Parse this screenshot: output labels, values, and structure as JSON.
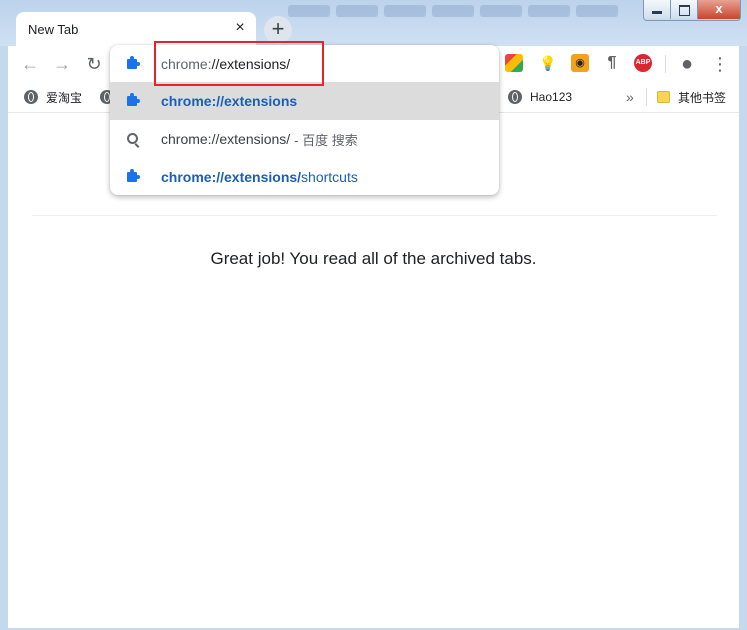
{
  "window": {
    "tab_title": "New Tab",
    "close_glyph": "×",
    "new_tab_glyph": "+",
    "controls": {
      "minimize": "",
      "maximize": "",
      "close": "x"
    }
  },
  "toolbar": {
    "back_glyph": "←",
    "forward_glyph": "→",
    "reload_glyph": "↻",
    "menu_glyph": "⋮",
    "extensions": [
      {
        "name": "color-extension-icon",
        "color": "#e8453c"
      },
      {
        "name": "bulb-extension-icon",
        "color": "#5f6368"
      },
      {
        "name": "tampermonkey-extension-icon",
        "color": "#f2a31b"
      },
      {
        "name": "pilcrow-extension-icon",
        "label": "¶",
        "color": "#5f6368"
      },
      {
        "name": "adblock-extension-icon",
        "label": "ABP",
        "color": "#d9262f"
      }
    ]
  },
  "bookmarks": {
    "items": [
      "爱淘宝",
      "Hao123"
    ],
    "overflow_glyph": "»",
    "other_folder": "其他书签"
  },
  "omnibox": {
    "input": {
      "prefix": "chrome:",
      "rest": "//extensions/"
    },
    "suggestions": [
      {
        "bold": "chrome://extensions",
        "rest": ""
      },
      {
        "text": "chrome://extensions/",
        "sub": "- 百度 搜索"
      },
      {
        "bold": "chrome://extensions/",
        "rest": "shortcuts"
      }
    ]
  },
  "content": {
    "message": "Great job! You read all of the archived tabs."
  },
  "colors": {
    "accent": "#1a73e8",
    "highlight_box": "#e3262b",
    "selected_row": "#dcdcdc"
  }
}
